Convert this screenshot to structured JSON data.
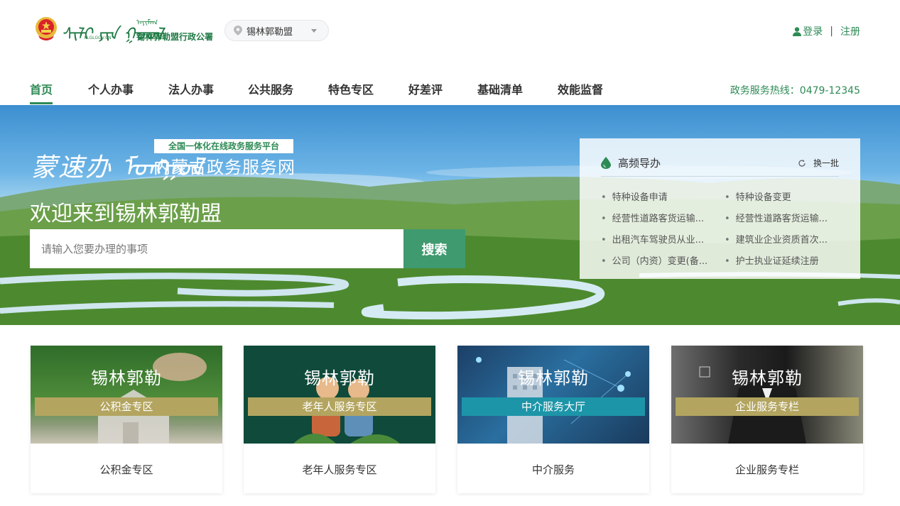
{
  "header": {
    "logo_mongolian": "ᠰᠢᠯᠢ ᠶᠢᠨ ᠭᠣᠣᠯ",
    "logo_mongolian_small": "ᠠᠶᠢᠮᠠᠭ",
    "logo_domain": "XLGLGOV.CN",
    "logo_chinese": "锡林郭勒盟行政公署",
    "region_selected": "锡林郭勒盟",
    "login_label": "登录",
    "separator": "|",
    "register_label": "注册"
  },
  "nav": {
    "items": [
      {
        "label": "首页"
      },
      {
        "label": "个人办事"
      },
      {
        "label": "法人办事"
      },
      {
        "label": "公共服务"
      },
      {
        "label": "特色专区"
      },
      {
        "label": "好差评"
      },
      {
        "label": "基础清单"
      },
      {
        "label": "效能监督"
      }
    ],
    "hotline": "政务服务热线：0479-12345"
  },
  "banner": {
    "brand_mongolian": "蒙速办 ᠮᠣᠩᠭᠣᠯ",
    "brand_tag": "全国一体化在线政务服务平台",
    "brand_name": "内蒙古政务服务网",
    "welcome": "欢迎来到锡林郭勒盟",
    "search_placeholder": "请输入您要办理的事项",
    "search_button": "搜索"
  },
  "hot_guide": {
    "title": "高频导办",
    "refresh_label": "换一批",
    "items": [
      {
        "label": "特种设备申请"
      },
      {
        "label": "特种设备变更"
      },
      {
        "label": "经营性道路客货运输..."
      },
      {
        "label": "经营性道路客货运输..."
      },
      {
        "label": "出租汽车驾驶员从业..."
      },
      {
        "label": "建筑业企业资质首次..."
      },
      {
        "label": "公司（内资）变更(备..."
      },
      {
        "label": "护士执业证延续注册"
      }
    ]
  },
  "cards": [
    {
      "city": "锡林郭勒",
      "strip": "公积金专区",
      "label": "公积金专区",
      "strip_color": "#b3a560"
    },
    {
      "city": "锡林郭勒",
      "strip": "老年人服务专区",
      "label": "老年人服务专区",
      "strip_color": "#b3a560"
    },
    {
      "city": "锡林郭勒",
      "strip": "中介服务大厅",
      "label": "中介服务",
      "strip_color": "#1d95a8"
    },
    {
      "city": "锡林郭勒",
      "strip": "企业服务专栏",
      "label": "企业服务专栏",
      "strip_color": "#b3a560"
    }
  ],
  "colors": {
    "accent": "#2d8a55",
    "search_button": "#3f9a6f"
  },
  "icons": {
    "emblem": "national-emblem-icon",
    "region": "location-pin-icon",
    "user": "user-icon",
    "hot": "droplet-icon",
    "refresh": "refresh-icon"
  }
}
